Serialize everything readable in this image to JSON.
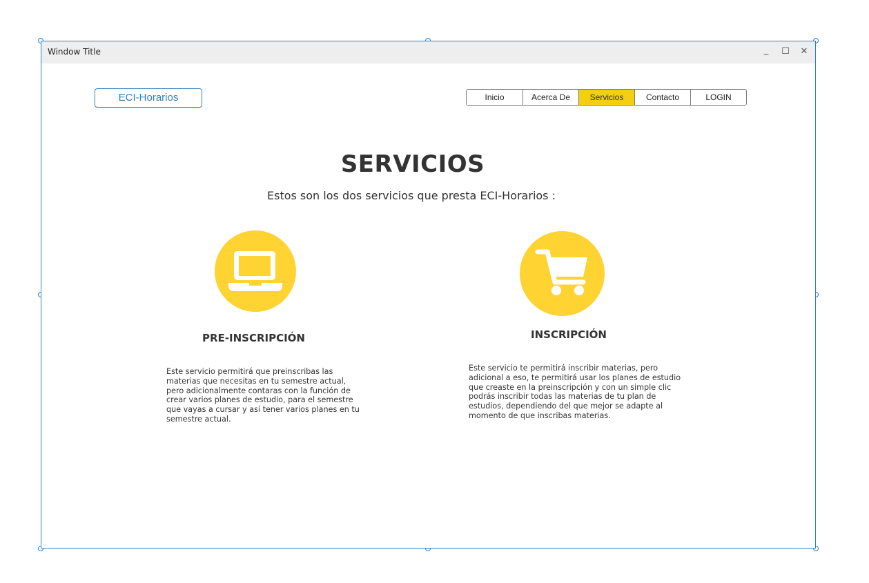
{
  "window": {
    "title": "Window Title",
    "minimize_glyph": "_",
    "maximize_glyph": "☐",
    "close_glyph": "✕"
  },
  "header": {
    "logo_label": "ECI-Horarios"
  },
  "nav": {
    "items": [
      {
        "label": "Inicio"
      },
      {
        "label": "Acerca De"
      },
      {
        "label": "Servicios"
      },
      {
        "label": "Contacto"
      },
      {
        "label": "LOGIN"
      }
    ],
    "active_index": 2
  },
  "main": {
    "title": "SERVICIOS",
    "subtitle": "Estos son los dos servicios que presta ECI-Horarios :"
  },
  "services": [
    {
      "icon": "laptop-icon",
      "title": "PRE-INSCRIPCIÓN",
      "description": "Este servicio permitirá que preinscribas las materias que necesitas en tu semestre actual, pero adicionalmente contaras con la función de crear varios planes de estudio, para el semestre que vayas a cursar y así tener varios planes en tu semestre actual."
    },
    {
      "icon": "shopping-cart-icon",
      "title": "INSCRIPCIÓN",
      "description": "Este servicio te permitirá inscribir materias, pero adicional a eso, te permitirá usar los planes de estudio que creaste en la preinscripción y con un simple clic podrás inscribir todas las materias de tu plan de estudios, dependiendo del que mejor se adapte al momento de que inscribas materias."
    }
  ],
  "colors": {
    "accent": "#2e7fc0",
    "highlight": "#f4cf10",
    "icon_circle": "#ffd332"
  }
}
